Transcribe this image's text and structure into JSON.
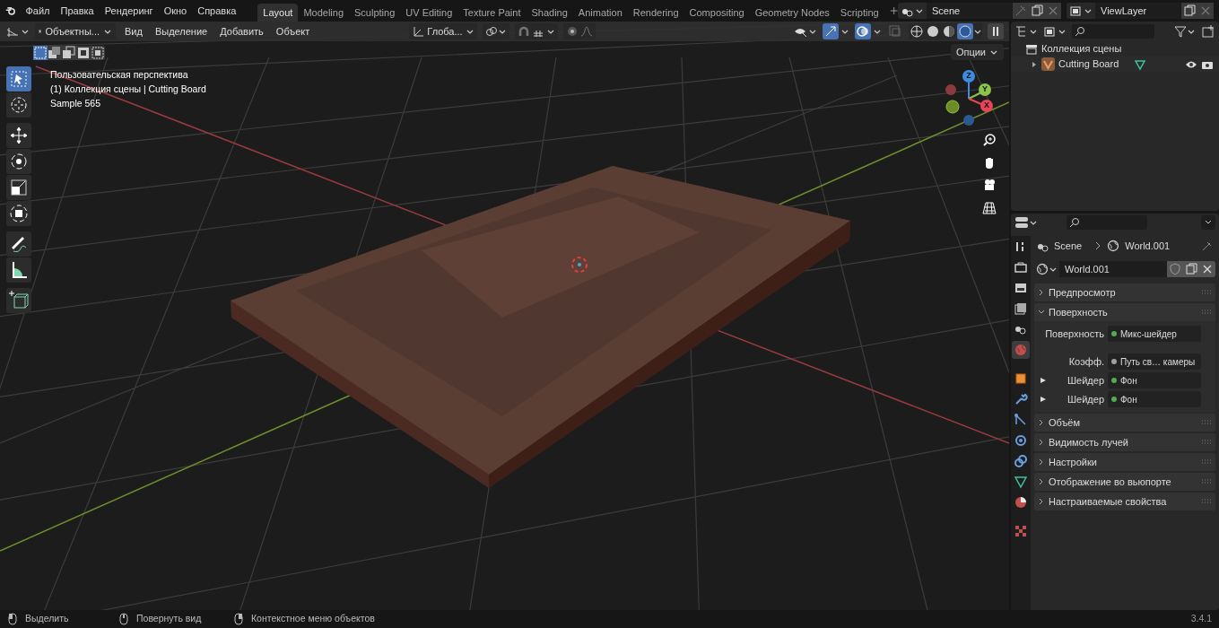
{
  "menu": [
    "Файл",
    "Правка",
    "Рендеринг",
    "Окно",
    "Справка"
  ],
  "workspaces": [
    {
      "label": "Layout",
      "selected": true
    },
    {
      "label": "Modeling",
      "selected": false
    },
    {
      "label": "Sculpting",
      "selected": false
    },
    {
      "label": "UV Editing",
      "selected": false
    },
    {
      "label": "Texture Paint",
      "selected": false
    },
    {
      "label": "Shading",
      "selected": false
    },
    {
      "label": "Animation",
      "selected": false
    },
    {
      "label": "Rendering",
      "selected": false
    },
    {
      "label": "Compositing",
      "selected": false
    },
    {
      "label": "Geometry Nodes",
      "selected": false
    },
    {
      "label": "Scripting",
      "selected": false
    }
  ],
  "scene": "Scene",
  "view_layer": "ViewLayer",
  "viewport_header": {
    "mode": "Объектны...",
    "menus": [
      "Вид",
      "Выделение",
      "Добавить",
      "Объект"
    ],
    "orientation": "Глоба..."
  },
  "select_modes": [
    {
      "selected": true
    },
    {
      "selected": false
    },
    {
      "selected": false
    },
    {
      "selected": false
    },
    {
      "selected": false
    }
  ],
  "options": "Опции",
  "shading_modes": [
    {
      "selected": false
    },
    {
      "selected": false
    },
    {
      "selected": false
    },
    {
      "selected": true
    }
  ],
  "overlay_lines": [
    "Пользовательская перспектива",
    "(1) Коллекция сцены | Cutting Board",
    "Sample 565"
  ],
  "tools": [
    {
      "kind": "select",
      "selected": true
    },
    {
      "kind": "cursor",
      "selected": false
    },
    {
      "kind": "move",
      "selected": false
    },
    {
      "kind": "rotate",
      "selected": false
    },
    {
      "kind": "scale",
      "selected": false
    },
    {
      "kind": "transform",
      "selected": false
    },
    {
      "kind": "annotate",
      "selected": false
    },
    {
      "kind": "measure",
      "selected": false
    },
    {
      "kind": "add",
      "selected": false
    }
  ],
  "gizmo": {
    "z": "Z",
    "y": "Y",
    "x": "X"
  },
  "outliner": {
    "collection": "Коллекция сцены",
    "items": [
      {
        "label": "Cutting Board"
      }
    ]
  },
  "properties": {
    "breadcrumb": [
      "Scene",
      "World.001"
    ],
    "world": "World.001",
    "tabs": [
      {
        "kind": "tool",
        "selected": false
      },
      {
        "kind": "render",
        "selected": false
      },
      {
        "kind": "output",
        "selected": false
      },
      {
        "kind": "view",
        "selected": false
      },
      {
        "kind": "scene",
        "selected": false
      },
      {
        "kind": "world",
        "selected": true
      },
      {
        "kind": "object",
        "selected": false
      },
      {
        "kind": "modifier",
        "selected": false
      },
      {
        "kind": "particles",
        "selected": false
      },
      {
        "kind": "physics",
        "selected": false
      },
      {
        "kind": "constraints",
        "selected": false
      },
      {
        "kind": "data",
        "selected": false
      },
      {
        "kind": "material",
        "selected": false
      },
      {
        "kind": "texture",
        "selected": false
      }
    ],
    "panels": [
      {
        "title": "Предпросмотр",
        "expanded": false
      },
      {
        "title": "Поверхность",
        "expanded": true,
        "rows": [
          {
            "label": "Поверхность",
            "value": "Микс-шейдер",
            "color": "#4caf50",
            "expandable": false
          },
          {
            "label": "Коэфф.",
            "value": "Путь св… камеры",
            "color": "#a0a0a0",
            "expandable": false
          },
          {
            "label": "Шейдер",
            "value": "Фон",
            "color": "#4caf50",
            "expandable": true
          },
          {
            "label": "Шейдер",
            "value": "Фон",
            "color": "#4caf50",
            "expandable": true
          }
        ]
      },
      {
        "title": "Объём",
        "expanded": false
      },
      {
        "title": "Видимость лучей",
        "expanded": false
      },
      {
        "title": "Настройки",
        "expanded": false
      },
      {
        "title": "Отображение во вьюпорте",
        "expanded": false
      },
      {
        "title": "Настраиваемые свойства",
        "expanded": false
      }
    ]
  },
  "status_bar": {
    "hints": [
      "Выделить",
      "Повернуть вид",
      "Контекстное меню объектов"
    ],
    "version": "3.4.1"
  }
}
